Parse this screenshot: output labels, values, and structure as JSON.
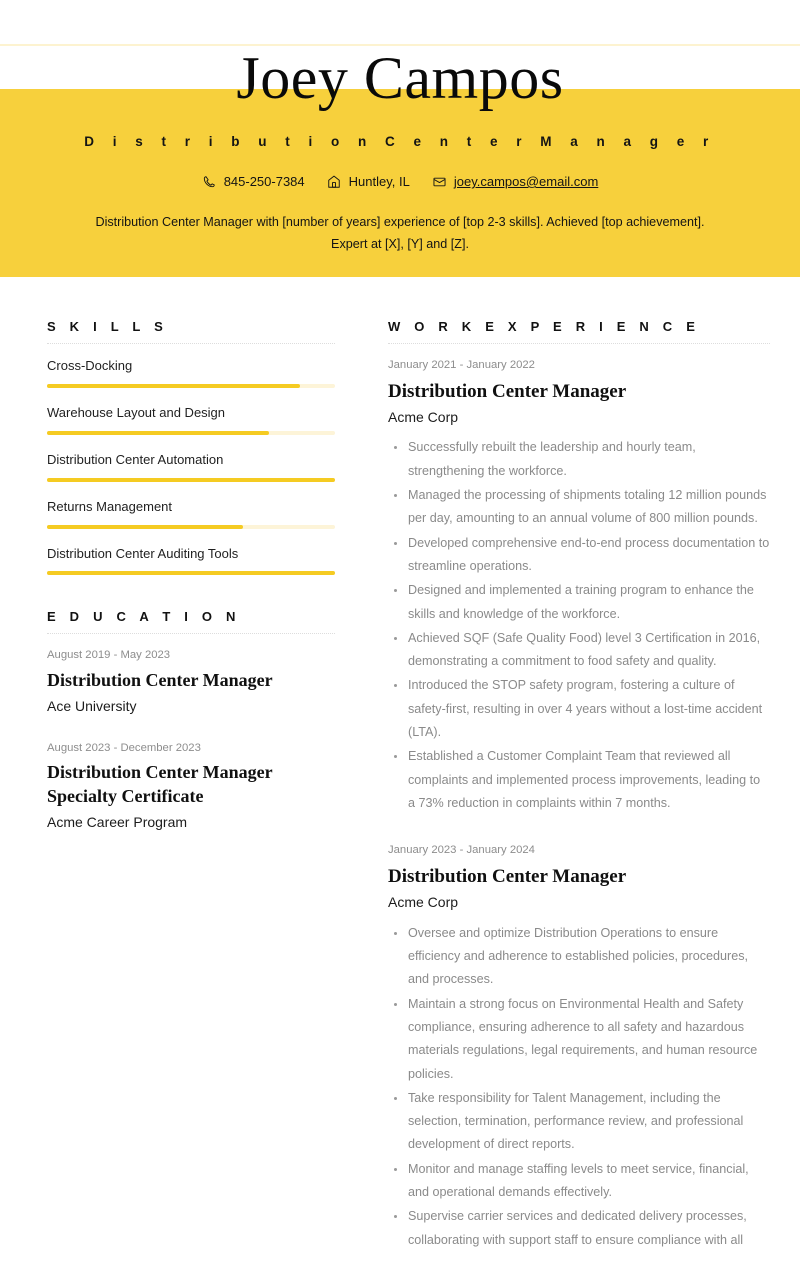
{
  "theme": {
    "band_color": "#f7d03c",
    "bar_fill_color": "#f5cb22",
    "bar_track_color": "#fdf4d8",
    "muted_text_color": "#8a8a8a"
  },
  "header": {
    "name": "Joey Campos",
    "job_title": "D i s t r i b u t i o n   C e n t e r   M a n a g e r",
    "contact": {
      "phone": "845-250-7384",
      "location": "Huntley, IL",
      "email": "joey.campos@email.com"
    },
    "summary_line_1": "Distribution Center Manager with [number of years] experience of [top 2-3 skills]. Achieved [top achievement].",
    "summary_line_2": "Expert at [X], [Y] and [Z]."
  },
  "skills": {
    "title": "S K I L L S",
    "items": [
      {
        "label": "Cross-Docking",
        "level": 88
      },
      {
        "label": "Warehouse Layout and Design",
        "level": 77
      },
      {
        "label": "Distribution Center Automation",
        "level": 100
      },
      {
        "label": "Returns Management",
        "level": 68
      },
      {
        "label": "Distribution Center Auditing Tools",
        "level": 100
      }
    ]
  },
  "education": {
    "title": "E D U C A T I O N",
    "items": [
      {
        "dates": "August 2019 - May 2023",
        "role": "Distribution Center Manager",
        "org": "Ace University"
      },
      {
        "dates": "August 2023 - December 2023",
        "role": "Distribution Center Manager Specialty Certificate",
        "org": "Acme Career Program"
      }
    ]
  },
  "work_experience": {
    "title": "W O R K   E X P E R I E N C E",
    "jobs": [
      {
        "dates": "January 2021 - January 2022",
        "role": "Distribution Center Manager",
        "org": "Acme Corp",
        "bullets": [
          "Successfully rebuilt the leadership and hourly team, strengthening the workforce.",
          "Managed the processing of shipments totaling 12 million pounds per day, amounting to an annual volume of 800 million pounds.",
          "Developed comprehensive end-to-end process documentation to streamline operations.",
          "Designed and implemented a training program to enhance the skills and knowledge of the workforce.",
          "Achieved SQF (Safe Quality Food) level 3 Certification in 2016, demonstrating a commitment to food safety and quality.",
          "Introduced the STOP safety program, fostering a culture of safety-first, resulting in over 4 years without a lost-time accident (LTA).",
          "Established a Customer Complaint Team that reviewed all complaints and implemented process improvements, leading to a 73% reduction in complaints within 7 months."
        ]
      },
      {
        "dates": "January 2023 - January 2024",
        "role": "Distribution Center Manager",
        "org": "Acme Corp",
        "bullets": [
          "Oversee and optimize Distribution Operations to ensure efficiency and adherence to established policies, procedures, and processes.",
          "Maintain a strong focus on Environmental Health and Safety compliance, ensuring adherence to all safety and hazardous materials regulations, legal requirements, and human resource policies.",
          "Take responsibility for Talent Management, including the selection, termination, performance review, and professional development of direct reports.",
          "Monitor and manage staffing levels to meet service, financial, and operational demands effectively.",
          "Supervise carrier services and dedicated delivery processes, collaborating with support staff to ensure compliance with all"
        ]
      }
    ]
  }
}
